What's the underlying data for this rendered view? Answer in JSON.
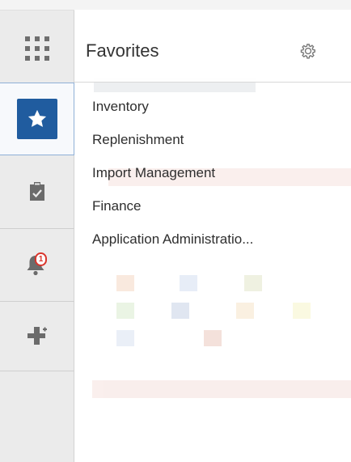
{
  "rail": {
    "items": [
      {
        "name": "apps-grid",
        "icon": "grid-icon"
      },
      {
        "name": "favorites",
        "icon": "star-icon",
        "active": true
      },
      {
        "name": "tasks",
        "icon": "clipboard-check-icon"
      },
      {
        "name": "notifications",
        "icon": "bell-icon",
        "badge": "1"
      },
      {
        "name": "add",
        "icon": "plus-icon"
      }
    ]
  },
  "panel": {
    "title": "Favorites",
    "settings_icon": "gear-icon",
    "items": [
      {
        "label": "Inventory"
      },
      {
        "label": "Replenishment"
      },
      {
        "label": "Import Management"
      },
      {
        "label": "Finance"
      },
      {
        "label": "Application Administratio..."
      }
    ]
  },
  "colors": {
    "accent": "#205c9f",
    "badge": "#d9342b",
    "rail_bg": "#ebebeb"
  }
}
